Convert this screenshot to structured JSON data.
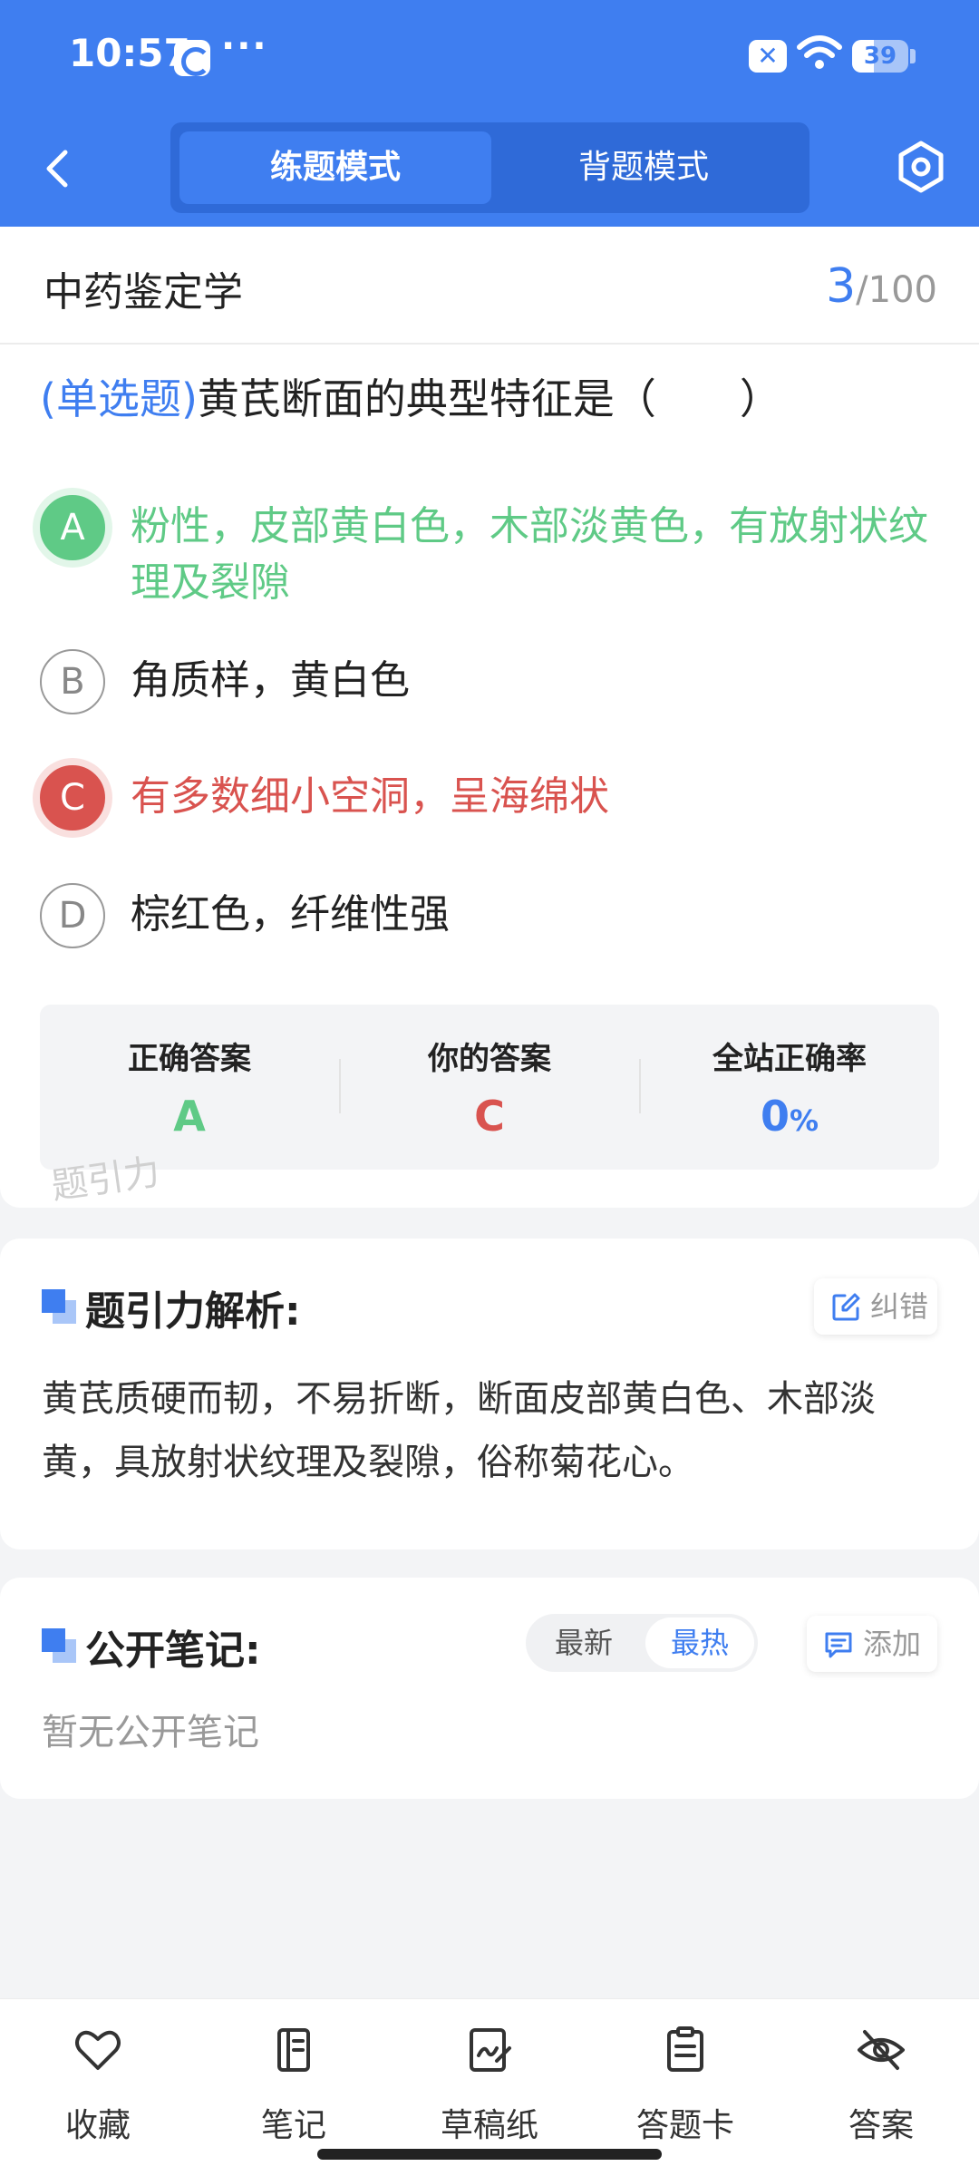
{
  "status_bar": {
    "time": "10:57",
    "dots": "···",
    "battery_level": "39",
    "battery_fraction": 0.39
  },
  "header": {
    "mode_practice": "练题模式",
    "mode_memorize": "背题模式",
    "active_mode": "练题模式"
  },
  "question_card": {
    "subject": "中药鉴定学",
    "progress_current": "3",
    "progress_total": "/100",
    "question_type": "(单选题)",
    "question_text": "黄芪断面的典型特征是（　　）",
    "options": [
      {
        "letter": "A",
        "text": "粉性，皮部黄白色，木部淡黄色，有放射状纹理及裂隙",
        "state": "correct"
      },
      {
        "letter": "B",
        "text": "角质样，黄白色",
        "state": "normal"
      },
      {
        "letter": "C",
        "text": "有多数细小空洞，呈海绵状",
        "state": "wrong"
      },
      {
        "letter": "D",
        "text": "棕红色，纤维性强",
        "state": "normal"
      }
    ],
    "stats": {
      "correct_label": "正确答案",
      "correct_value": "A",
      "yours_label": "你的答案",
      "yours_value": "C",
      "rate_label": "全站正确率",
      "rate_value": "0",
      "rate_unit": "%"
    },
    "watermark": "题引力"
  },
  "analysis": {
    "title": "题引力解析:",
    "report_label": "纠错",
    "text": "黄芪质硬而韧，不易折断，断面皮部黄白色、木部淡黄，具放射状纹理及裂隙，俗称菊花心。"
  },
  "notes": {
    "title": "公开笔记:",
    "sort_latest": "最新",
    "sort_hot": "最热",
    "active_sort": "最热",
    "add_label": "添加",
    "empty_text": "暂无公开笔记"
  },
  "bottom_nav": [
    {
      "label": "收藏",
      "icon": "heart-icon"
    },
    {
      "label": "笔记",
      "icon": "notebook-icon"
    },
    {
      "label": "草稿纸",
      "icon": "draft-paper-icon"
    },
    {
      "label": "答题卡",
      "icon": "answer-sheet-icon"
    },
    {
      "label": "答案",
      "icon": "eye-off-icon"
    }
  ],
  "colors": {
    "primary": "#3f7ef0",
    "correct": "#5fca86",
    "wrong": "#d9534f"
  }
}
